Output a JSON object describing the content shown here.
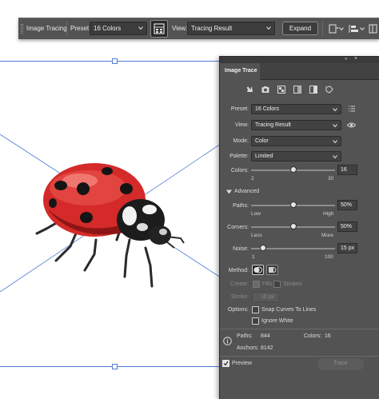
{
  "control_bar": {
    "image_tracing_label": "Image Tracing",
    "preset_label": "Preset:",
    "preset_value": "16 Colors",
    "view_label": "View:",
    "view_value": "Tracing Result",
    "expand_label": "Expand"
  },
  "panel": {
    "tab_title": "Image Trace",
    "preset_label": "Preset:",
    "preset_value": "16 Colors",
    "view_label": "View:",
    "view_value": "Tracing Result",
    "mode_label": "Mode:",
    "mode_value": "Color",
    "palette_label": "Palette:",
    "palette_value": "Limited",
    "colors_label": "Colors:",
    "colors_value": "16",
    "colors_min": "2",
    "colors_max": "30",
    "colors_level": 0.5,
    "advanced_label": "Advanced",
    "paths_label": "Paths:",
    "paths_value": "50%",
    "paths_min": "Low",
    "paths_max": "High",
    "paths_level": 0.5,
    "corners_label": "Corners:",
    "corners_value": "50%",
    "corners_min": "Less",
    "corners_max": "More",
    "corners_level": 0.5,
    "noise_label": "Noise:",
    "noise_value": "15 px",
    "noise_min": "1",
    "noise_max": "100",
    "noise_level": 0.14,
    "method_label": "Method:",
    "create_label": "Create:",
    "fills_label": "Fills",
    "strokes_label": "Strokes",
    "stroke_label": "Stroke:",
    "stroke_value": "10 px",
    "options_label": "Options:",
    "snap_label": "Snap Curves To Lines",
    "ignore_white_label": "Ignore White",
    "stat_paths_label": "Paths:",
    "stat_paths_value": "844",
    "stat_colors_label": "Colors:",
    "stat_colors_value": "16",
    "stat_anchors_label": "Anchors:",
    "stat_anchors_value": "8142",
    "preview_label": "Preview",
    "preview_checked": true,
    "trace_label": "Trace"
  },
  "colors": {
    "panel_bg": "#535353",
    "guide": "#4f7bd4",
    "ladybug_red": "#d42a2a"
  }
}
